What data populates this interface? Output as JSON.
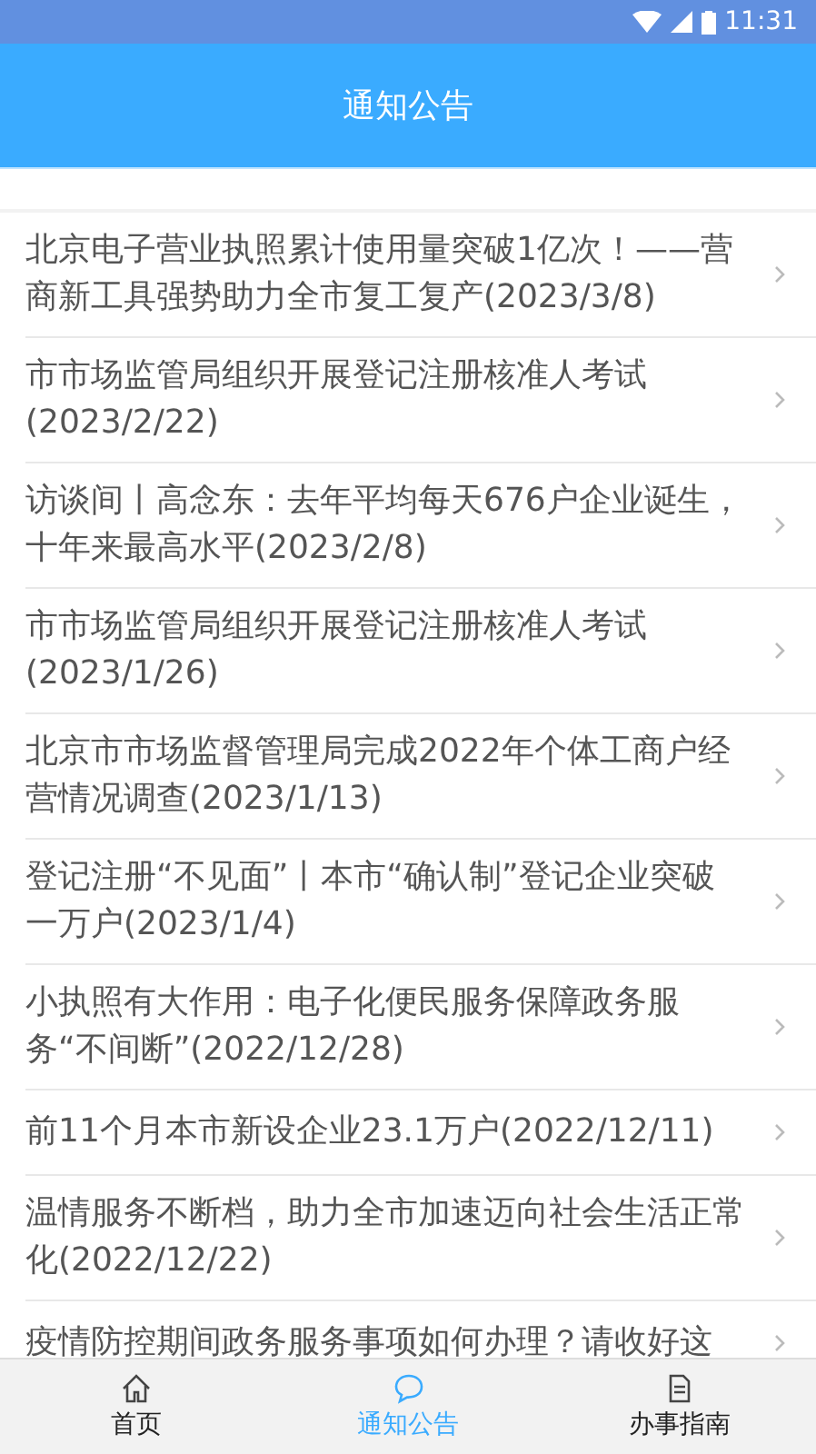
{
  "status_bar": {
    "time": "11:31"
  },
  "header": {
    "title": "通知公告"
  },
  "notices": [
    {
      "title": "北京电子营业执照累计使用量突破1亿次！——营商新工具强势助力全市复工复产(2023/3/8)"
    },
    {
      "title": "市市场监管局组织开展登记注册核准人考试(2023/2/22)"
    },
    {
      "title": "访谈间丨高念东：去年平均每天676户企业诞生，十年来最高水平(2023/2/8)"
    },
    {
      "title": "市市场监管局组织开展登记注册核准人考试(2023/1/26)"
    },
    {
      "title": "北京市市场监督管理局完成2022年个体工商户经营情况调查(2023/1/13)"
    },
    {
      "title": "登记注册“不见面”丨本市“确认制”登记企业突破一万户(2023/1/4)"
    },
    {
      "title": "小执照有大作用：电子化便民服务保障政务服务“不间断”(2022/12/28)"
    },
    {
      "title": "前11个月本市新设企业23.1万户(2022/12/11)"
    },
    {
      "title": "温情服务不断档，助力全市加速迈向社会生活正常化(2022/12/22)"
    },
    {
      "title": "疫情防控期间政务服务事项如何办理？请收好这"
    }
  ],
  "bottom_nav": [
    {
      "label": "首页",
      "kind": "home",
      "selected": false
    },
    {
      "label": "通知公告",
      "kind": "notice",
      "selected": true
    },
    {
      "label": "办事指南",
      "kind": "guide",
      "selected": false
    }
  ]
}
